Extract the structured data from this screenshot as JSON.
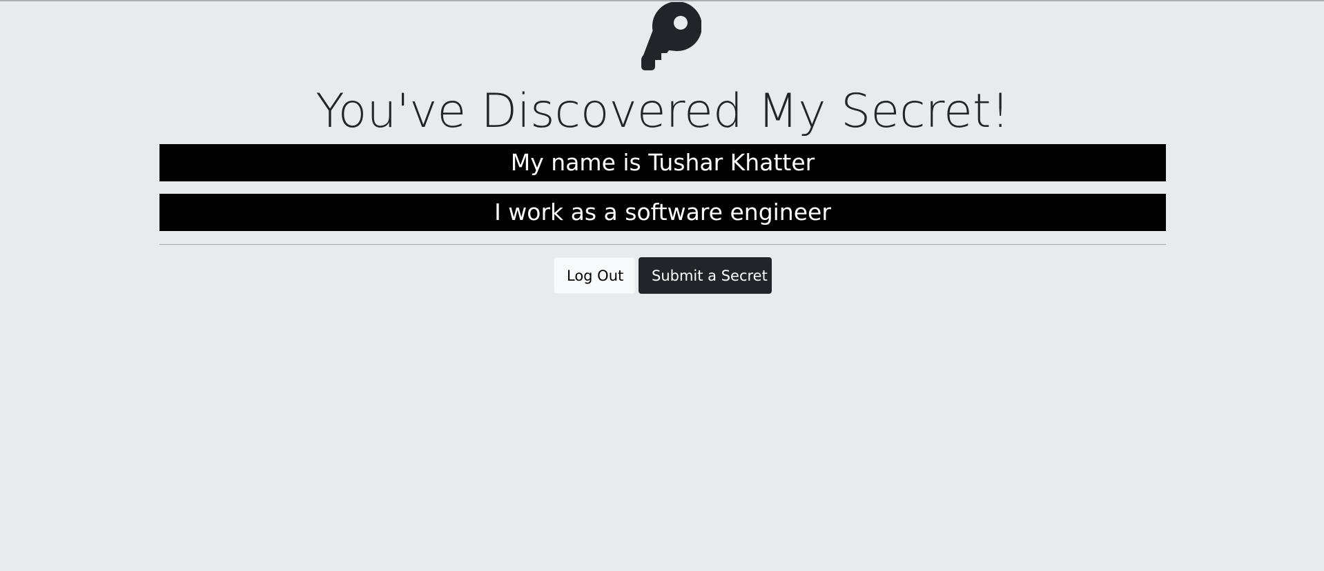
{
  "page": {
    "title": "You've Discovered My Secret!",
    "icon": "key-icon"
  },
  "secrets": [
    "My name is Tushar Khatter",
    "I work as a software engineer"
  ],
  "actions": {
    "logout_label": "Log Out",
    "submit_label": "Submit a Secret"
  },
  "colors": {
    "background": "#e8ebee",
    "secret_background": "#000000",
    "secret_text": "#ffffff",
    "dark_button": "#212529",
    "light_button": "#f8f9fa"
  }
}
